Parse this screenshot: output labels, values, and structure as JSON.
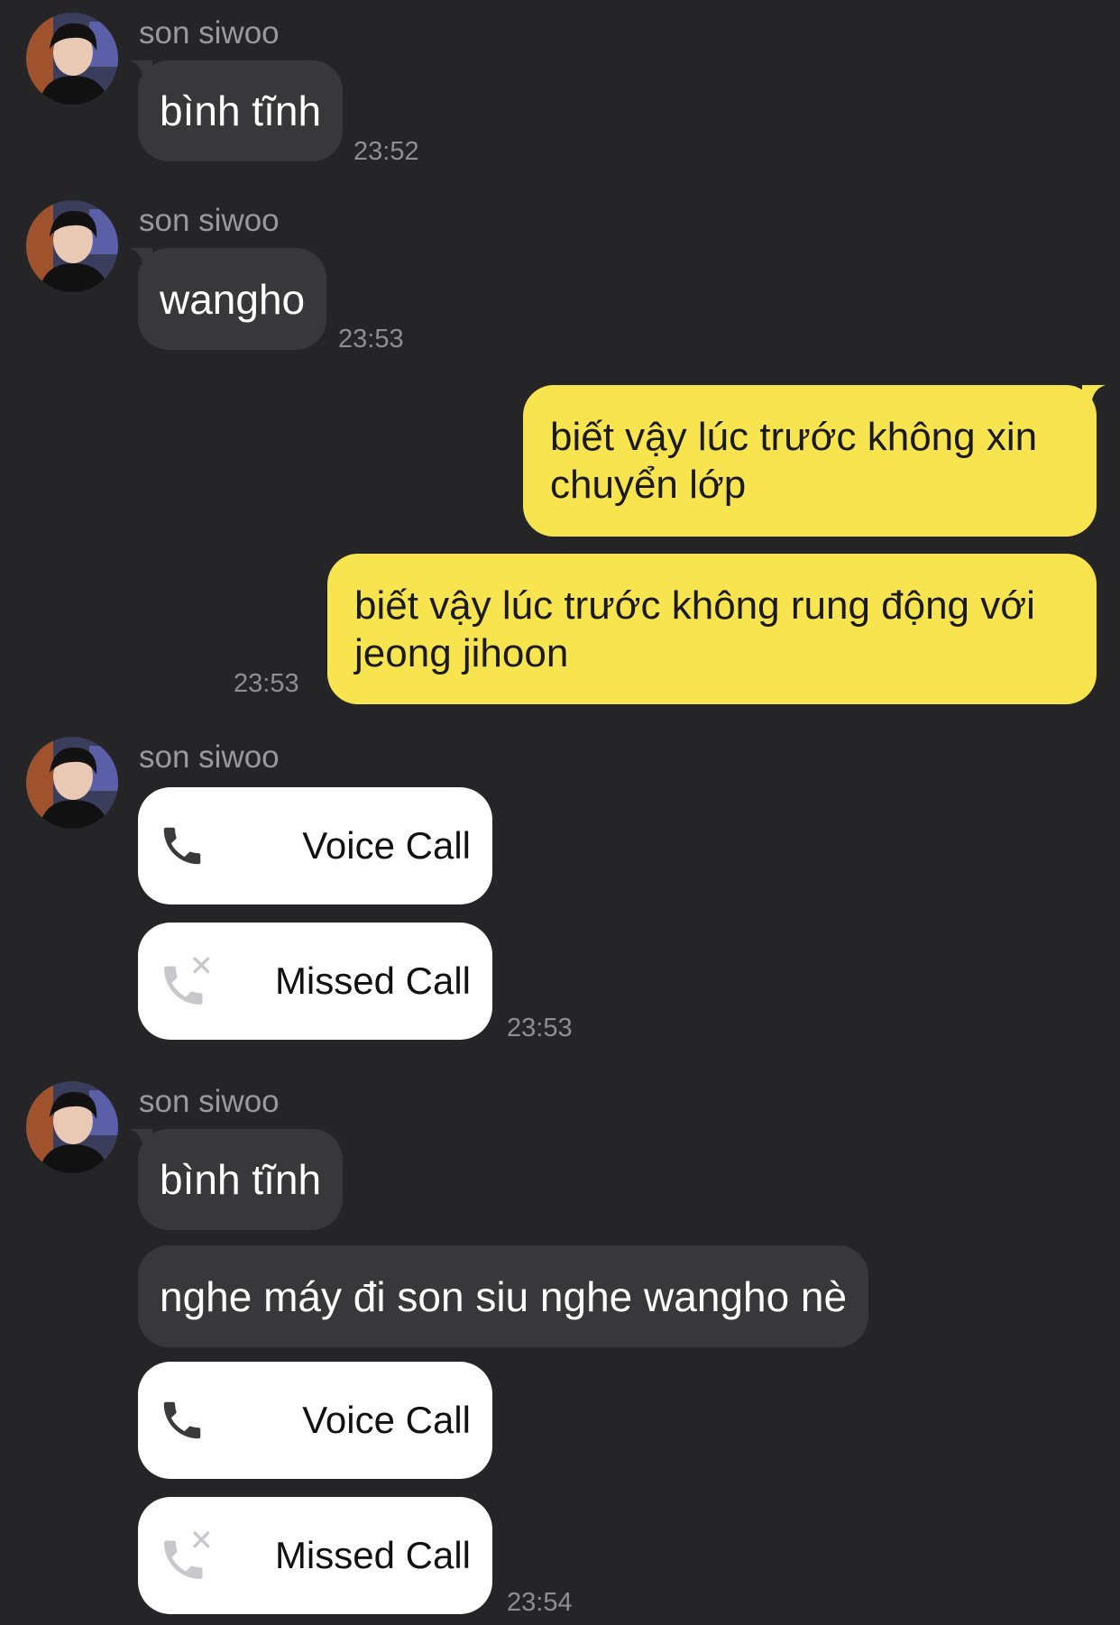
{
  "chat": {
    "sender_name": "son siwoo",
    "msg1": {
      "text": "bình tĩnh",
      "time": "23:52"
    },
    "msg2": {
      "text": "wangho",
      "time": "23:53"
    },
    "out1": {
      "line1": "biết vậy lúc trước không xin",
      "line2": "chuyển lớp"
    },
    "out2": {
      "line1": "biết vậy lúc trước không rung động với",
      "line2": "jeong jihoon",
      "time": "23:53"
    },
    "group3": {
      "voice_call": "Voice Call",
      "missed_call": "Missed Call",
      "time": "23:53"
    },
    "group4": {
      "msg1": "bình tĩnh",
      "msg2": "nghe máy đi son siu nghe wangho nè",
      "voice_call": "Voice Call",
      "missed_call": "Missed Call",
      "time": "23:54"
    }
  },
  "colors": {
    "background": "#252527",
    "incoming_bubble": "#38383b",
    "outgoing_bubble": "#f8e44e",
    "call_bubble": "#ffffff",
    "meta_text": "#8e8e93"
  },
  "icons": {
    "avatar": "profile-photo",
    "voice_call": "phone-icon",
    "missed_call": "missed-call-icon"
  }
}
